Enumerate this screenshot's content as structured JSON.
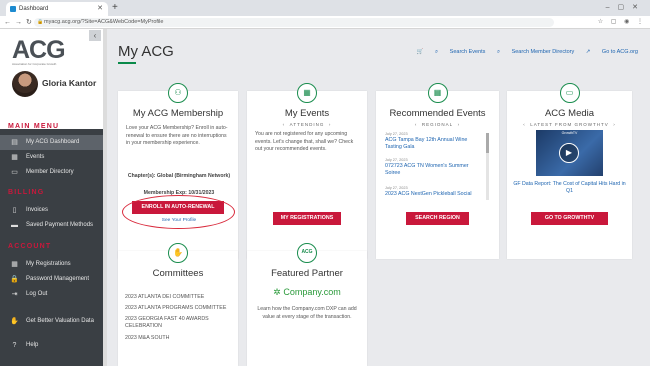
{
  "browser": {
    "tab_title": "Dashboard",
    "url": "myacg.acg.org/?Site=ACG&WebCode=MyProfile"
  },
  "sidebar": {
    "logo": "ACG",
    "logo_tagline": "Association for Corporate Growth",
    "user_name": "Gloria Kantor",
    "main_menu_heading": "MAIN MENU",
    "main_menu": [
      {
        "label": "My ACG Dashboard",
        "active": true
      },
      {
        "label": "Events",
        "active": false
      },
      {
        "label": "Member Directory",
        "active": false
      }
    ],
    "billing_heading": "BILLING",
    "billing": [
      {
        "label": "Invoices"
      },
      {
        "label": "Saved Payment Methods"
      }
    ],
    "account_heading": "ACCOUNT",
    "account": [
      {
        "label": "My Registrations"
      },
      {
        "label": "Password Management"
      },
      {
        "label": "Log Out"
      }
    ],
    "valuation": "Get Better Valuation Data",
    "help": "Help"
  },
  "header": {
    "page_title": "My ACG",
    "search_events": "Search Events",
    "search_directory": "Search Member Directory",
    "go_to_acg": "Go to ACG.org"
  },
  "membership": {
    "title": "My ACG Membership",
    "body": "Love your ACG Membership? Enroll in auto-renewal to ensure there are no interruptions in your membership experience.",
    "chapter": "Chapter(s): Global (Birmingham Network)",
    "expiry": "Membership Exp: 10/31/2023",
    "enroll_button": "ENROLL IN AUTO-RENEWAL",
    "see_profile": "See Your Profile"
  },
  "my_events": {
    "title": "My Events",
    "filter": "ATTENDING",
    "body": "You are not registered for any upcoming events. Let's change that, shall we? Check out your recommended events.",
    "button": "MY REGISTRATIONS"
  },
  "recommended": {
    "title": "Recommended Events",
    "filter": "REGIONAL",
    "events": [
      {
        "date": "July 27, 2023",
        "title": "ACG Tampa Bay 12th Annual Wine Tasting Gala"
      },
      {
        "date": "July 27, 2023",
        "title": "072723 ACG TN Women's Summer Soiree"
      },
      {
        "date": "July 27, 2023",
        "title": "2023 ACG NextGen Pickleball Social"
      }
    ],
    "button": "SEARCH REGION"
  },
  "media": {
    "title": "ACG Media",
    "filter": "LATEST FROM GROWTHTV",
    "video_badge": "GrowthTV",
    "caption": "GF Data Report: The Cost of Capital Hits Hard in Q1",
    "button": "GO TO GROWTHTV"
  },
  "committees": {
    "title": "Committees",
    "items": [
      "2023 ATLANTA DEI COMMITTEE",
      "2023 ATLANTA PROGRAMS COMMITTEE",
      "2023 GEORGIA FAST 40 AWARDS CELEBRATION",
      "2023 M&A SOUTH"
    ]
  },
  "partner": {
    "title": "Featured Partner",
    "icon_text": "ACG",
    "logo_text": "Company.com",
    "body": "Learn how the Company.com DXP can add value at every stage of the transaction."
  },
  "colors": {
    "accent": "#c9183b",
    "brand_green": "#1a8d4e",
    "link": "#1d64b0",
    "sidebar": "#3a3f44"
  }
}
